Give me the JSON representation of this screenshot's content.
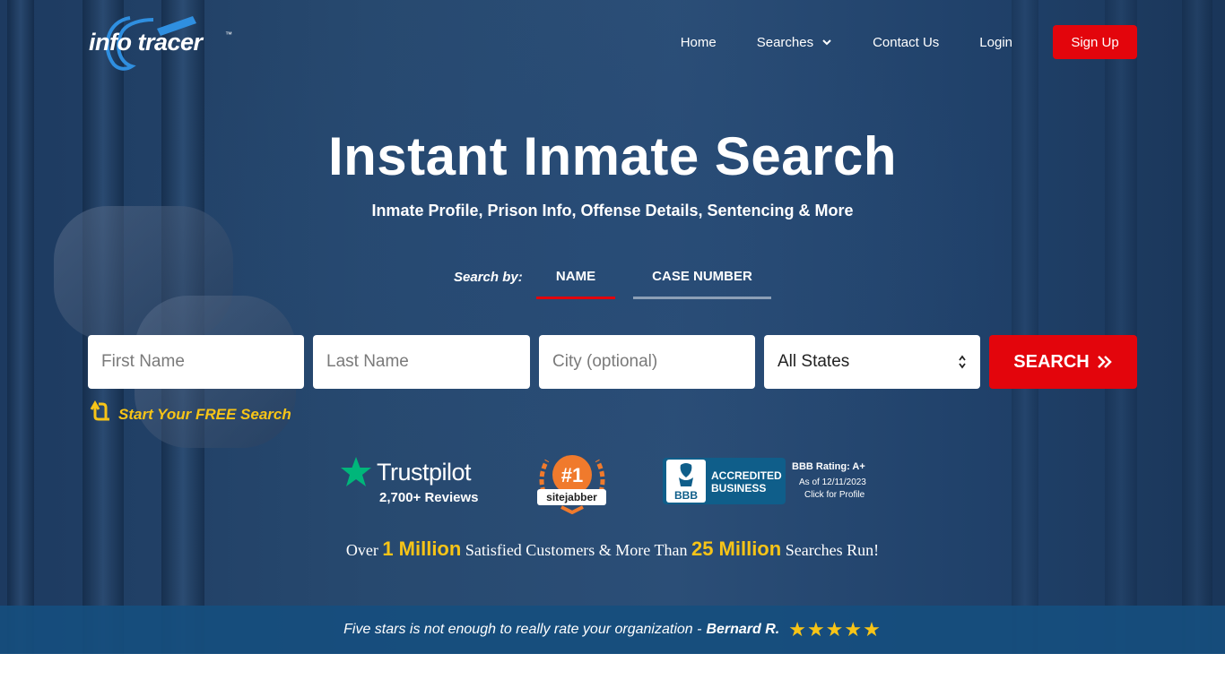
{
  "brand": {
    "logo_text": "info tracer",
    "trademark": "™"
  },
  "nav": {
    "items": [
      {
        "label": "Home"
      },
      {
        "label": "Searches"
      },
      {
        "label": "Contact Us"
      },
      {
        "label": "Login"
      }
    ],
    "signup_label": "Sign Up"
  },
  "hero": {
    "title": "Instant Inmate Search",
    "subtitle": "Inmate Profile, Prison Info, Offense Details, Sentencing & More"
  },
  "search_by": {
    "label": "Search by:",
    "tabs": [
      {
        "label": "NAME",
        "active": true
      },
      {
        "label": "CASE NUMBER",
        "active": false
      }
    ]
  },
  "form": {
    "first_name_placeholder": "First Name",
    "last_name_placeholder": "Last Name",
    "city_placeholder": "City (optional)",
    "state_selected": "All States",
    "submit_label": "SEARCH",
    "hint": "Start Your FREE Search"
  },
  "badges": {
    "trustpilot": {
      "name": "Trustpilot",
      "reviews": "2,700+ Reviews"
    },
    "sitejabber": {
      "rank": "#1",
      "name": "sitejabber"
    },
    "bbb": {
      "logo": "BBB",
      "line1": "ACCREDITED",
      "line2": "BUSINESS",
      "rating": "BBB Rating: A+",
      "as_of": "As of 12/11/2023",
      "link": "Click for Profile"
    }
  },
  "stats": {
    "prefix": "Over",
    "customers": "1 Million",
    "middle": "Satisfied Customers & More Than",
    "searches": "25 Million",
    "suffix": "Searches Run!"
  },
  "testimonial": {
    "quote": "Five stars is not enough to really rate your organization -",
    "author": "Bernard R.",
    "stars": "★★★★★",
    "rating": 5
  },
  "colors": {
    "accent_red": "#e3050c",
    "highlight_yellow": "#f7c417",
    "hero_blue": "#27496f",
    "strip_blue": "#164e7e",
    "trustpilot_green": "#00b67a",
    "sitejabber_orange": "#f07a2c",
    "bbb_blue": "#0f5e8a"
  }
}
